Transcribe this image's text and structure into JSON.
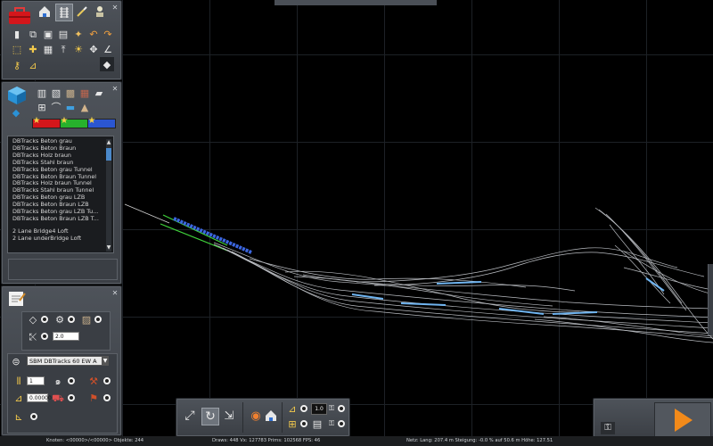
{
  "tracks": {
    "items": [
      "DBTracks Beton grau",
      "DBTracks Beton Braun",
      "DBTracks Holz braun",
      "DBTracks Stahl braun",
      "DBTracks Beton grau Tunnel",
      "DBTracks Beton Braun Tunnel",
      "DBTracks Holz braun Tunnel",
      "DBTracks Stahl braun Tunnel",
      "DBTracks Beton grau LZB",
      "DBTracks Beton Braun LZB",
      "DBTracks Beton grau LZB Tu...",
      "DBTracks Beton Braun LZB T..."
    ],
    "items2": [
      "2 Lane Bridge4 Loft",
      "2 Lane underBridge Loft"
    ]
  },
  "props": {
    "value_field": "2.0",
    "track_select": "SBM DBTracks 60 EW A",
    "field_one": "1",
    "field_gradient": "0.00000"
  },
  "bottom": {
    "cam_value": "1.0"
  },
  "status": {
    "left": "Knoten: <00000>/<00000>  Objekte: 244",
    "mid": "Draws: 448  Vx: 127783  Prims: 102568  FPS: 46",
    "right": "Netz: Lang:  207.4 m  Steigung: -0.0 % auf 50.6 m  Höhe: 127.51"
  },
  "colors": {
    "track_gray": "#b9bcc1",
    "track_blue": "#6fb4f0",
    "track_green": "#3fd13a",
    "track_selected": "#3b66e0",
    "swatch_red": "#d4161b",
    "swatch_green": "#27b12c",
    "swatch_blue": "#2b56d2"
  },
  "icons": {
    "toolbox": "red-toolbox-icon",
    "play": "orange-play-icon",
    "cube": "blue-cube-icon"
  }
}
